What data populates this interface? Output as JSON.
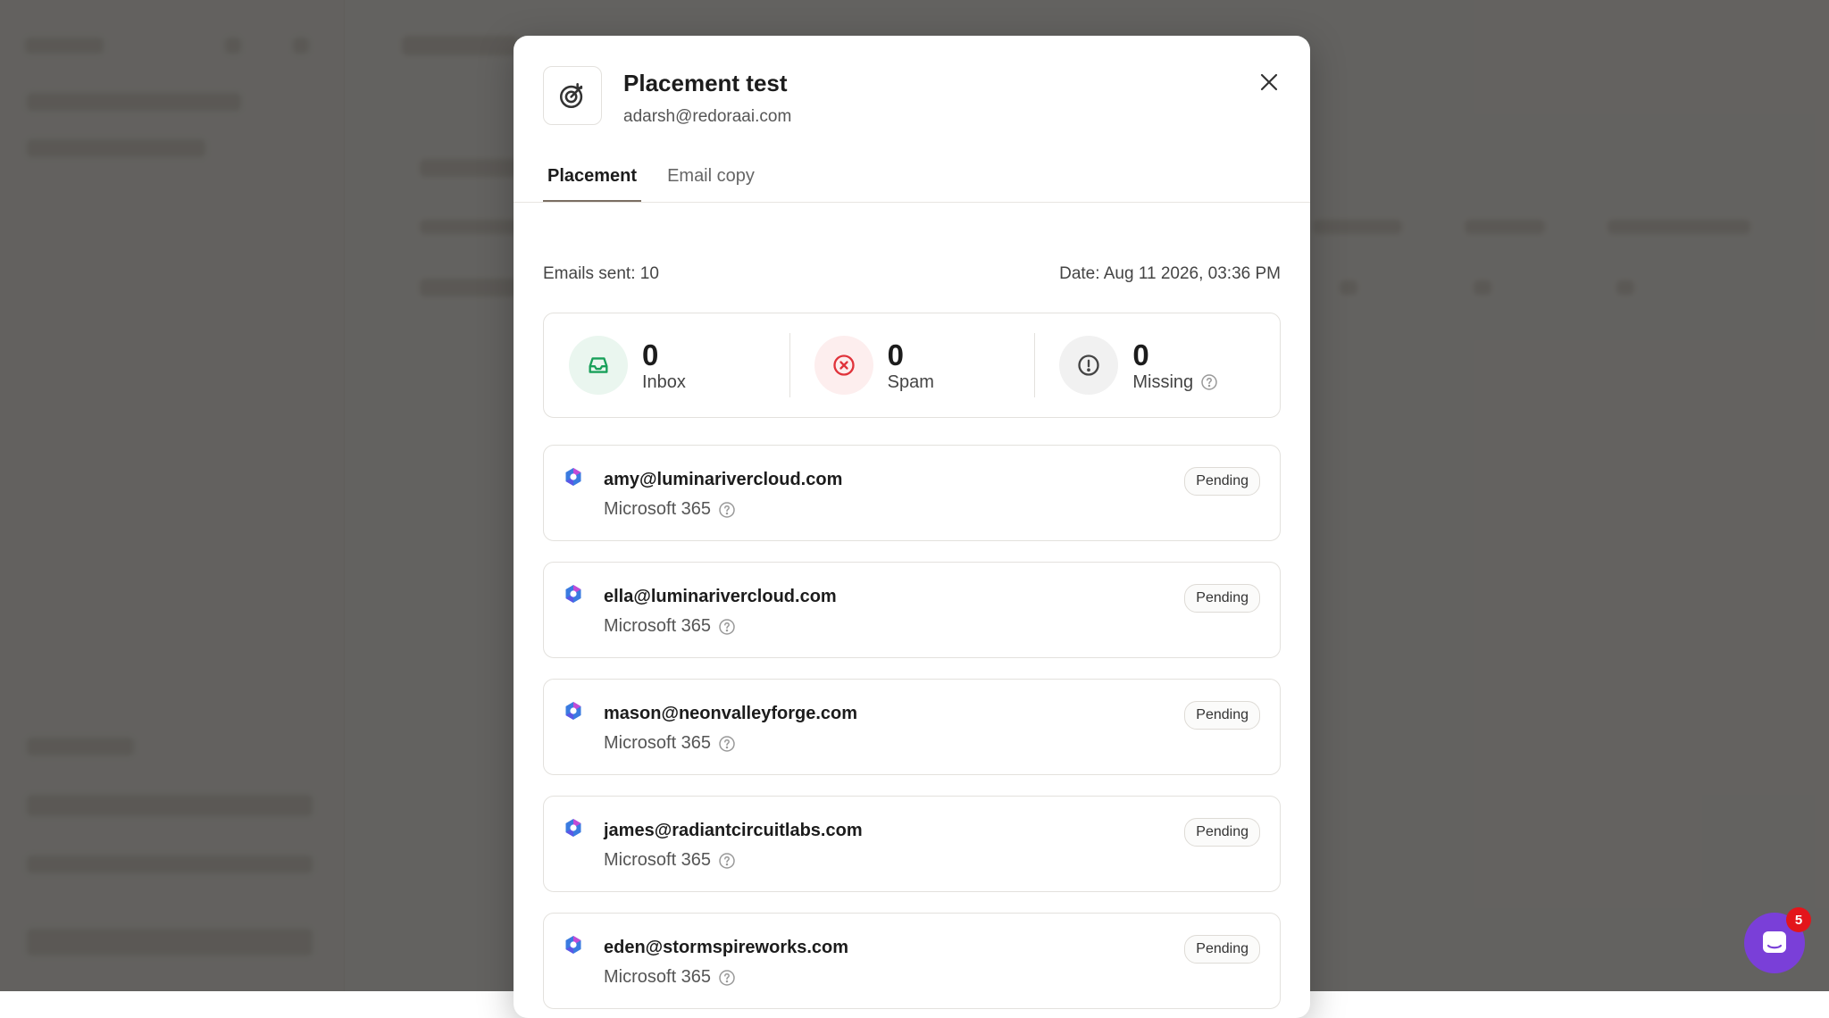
{
  "modal": {
    "title": "Placement test",
    "subtitle": "adarsh@redoraai.com",
    "tabs": [
      {
        "label": "Placement",
        "active": true
      },
      {
        "label": "Email copy",
        "active": false
      }
    ],
    "emails_sent": "Emails sent: 10",
    "date": "Date: Aug 11 2026, 03:36 PM",
    "stats": [
      {
        "value": "0",
        "label": "Inbox",
        "icon": "inbox-icon",
        "color": "#19a05a"
      },
      {
        "value": "0",
        "label": "Spam",
        "icon": "x-circle-icon",
        "color": "#e0333b"
      },
      {
        "value": "0",
        "label": "Missing",
        "icon": "alert-circle-icon",
        "color": "#444444"
      }
    ],
    "rows": [
      {
        "email": "amy@luminarivercloud.com",
        "provider": "Microsoft 365",
        "status": "Pending"
      },
      {
        "email": "ella@luminarivercloud.com",
        "provider": "Microsoft 365",
        "status": "Pending"
      },
      {
        "email": "mason@neonvalleyforge.com",
        "provider": "Microsoft 365",
        "status": "Pending"
      },
      {
        "email": "james@radiantcircuitlabs.com",
        "provider": "Microsoft 365",
        "status": "Pending"
      },
      {
        "email": "eden@stormspireworks.com",
        "provider": "Microsoft 365",
        "status": "Pending"
      }
    ]
  },
  "chat": {
    "badge_count": "5",
    "accent": "#7a3fd8"
  }
}
